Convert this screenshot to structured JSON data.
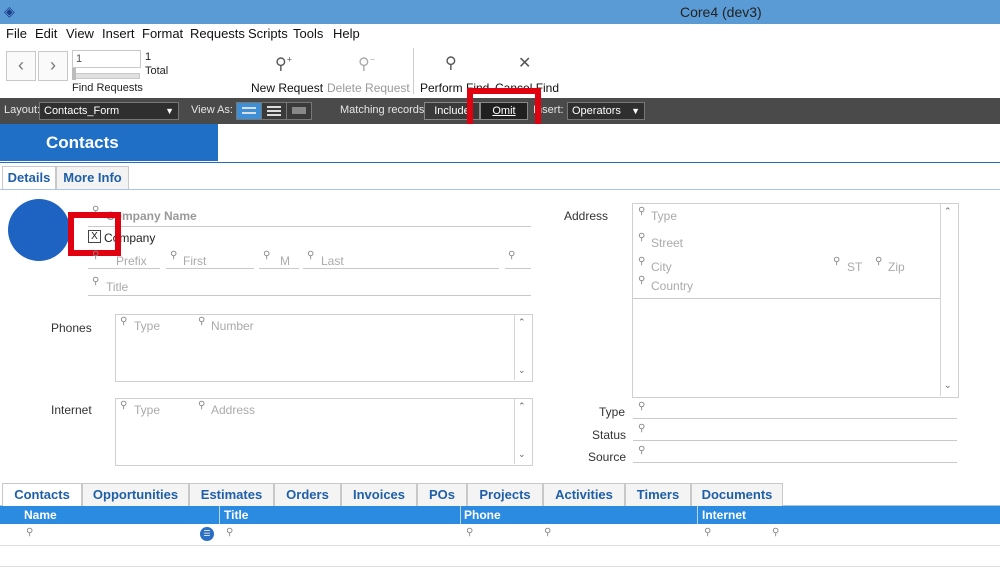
{
  "window": {
    "title": "Core4 (dev3)"
  },
  "menu": [
    "File",
    "Edit",
    "View",
    "Insert",
    "Format",
    "Requests",
    "Scripts",
    "Tools",
    "Help"
  ],
  "toolbar": {
    "record_value": "1",
    "found_count": "1",
    "total_label": "Total",
    "find_requests_label": "Find Requests",
    "new_request_label": "New Request",
    "delete_request_label": "Delete Request",
    "perform_find_label": "Perform Find",
    "cancel_find_label": "Cancel Find"
  },
  "layoutbar": {
    "layout_label": "Layout:",
    "layout_value": "Contacts_Form",
    "view_as_label": "View As:",
    "matching_label": "Matching records:",
    "include_label": "Include",
    "omit_label": "Omit",
    "insert_label": "Insert:",
    "operators_label": "Operators"
  },
  "header": {
    "title": "Contacts"
  },
  "tabs": [
    "Details",
    "More Info"
  ],
  "form": {
    "company_name_placeholder": "Company Name",
    "company_checkbox_label": "Company",
    "company_checkbox_mark": "X",
    "prefix_placeholder": "Prefix",
    "first_placeholder": "First",
    "middle_placeholder": "M",
    "last_placeholder": "Last",
    "title_placeholder": "Title",
    "phones_label": "Phones",
    "phones_type_placeholder": "Type",
    "phones_number_placeholder": "Number",
    "internet_label": "Internet",
    "internet_type_placeholder": "Type",
    "internet_address_placeholder": "Address",
    "address_label": "Address",
    "address_type_placeholder": "Type",
    "street_placeholder": "Street",
    "city_placeholder": "City",
    "state_placeholder": "ST",
    "zip_placeholder": "Zip",
    "country_placeholder": "Country",
    "type_label": "Type",
    "status_label": "Status",
    "source_label": "Source"
  },
  "bottom_tabs": [
    "Contacts",
    "Opportunities",
    "Estimates",
    "Orders",
    "Invoices",
    "POs",
    "Projects",
    "Activities",
    "Timers",
    "Documents"
  ],
  "grid": {
    "columns": [
      "Name",
      "Title",
      "Phone",
      "Internet"
    ]
  },
  "highlight_color": "#e10010",
  "accent_color": "#1f6fc6"
}
